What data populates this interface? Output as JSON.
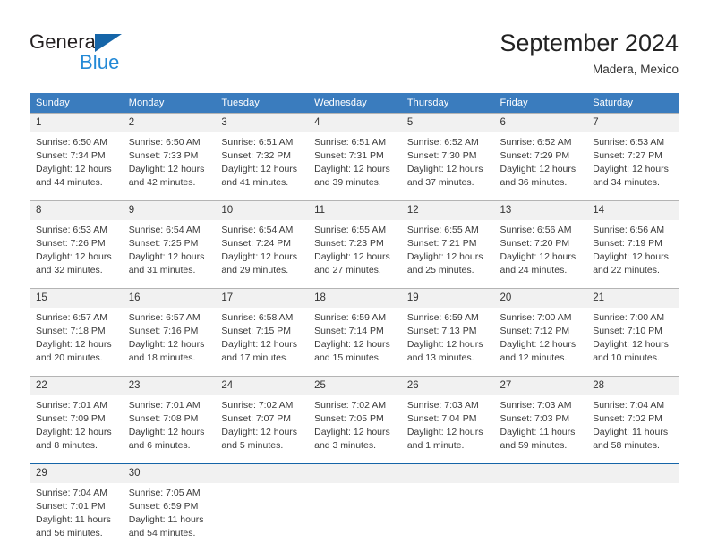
{
  "brand": {
    "name_part1": "General",
    "name_part2": "Blue",
    "triangle_color": "#1565a8",
    "blue_color": "#2389d6"
  },
  "header": {
    "title": "September 2024",
    "location": "Madera, Mexico"
  },
  "theme": {
    "header_bar": "#3a7cbe",
    "daynum_band": "#f1f1f1",
    "rule_gray": "#b4b4b4",
    "rule_blue": "#1565a8"
  },
  "weekday_headers": [
    "Sunday",
    "Monday",
    "Tuesday",
    "Wednesday",
    "Thursday",
    "Friday",
    "Saturday"
  ],
  "labels": {
    "sunrise_prefix": "Sunrise:",
    "sunset_prefix": "Sunset:",
    "daylight_prefix": "Daylight:"
  },
  "weeks": [
    {
      "rule": "gray",
      "days": [
        {
          "num": "1",
          "sunrise": "Sunrise: 6:50 AM",
          "sunset": "Sunset: 7:34 PM",
          "daylight_line1": "Daylight: 12 hours",
          "daylight_line2": "and 44 minutes."
        },
        {
          "num": "2",
          "sunrise": "Sunrise: 6:50 AM",
          "sunset": "Sunset: 7:33 PM",
          "daylight_line1": "Daylight: 12 hours",
          "daylight_line2": "and 42 minutes."
        },
        {
          "num": "3",
          "sunrise": "Sunrise: 6:51 AM",
          "sunset": "Sunset: 7:32 PM",
          "daylight_line1": "Daylight: 12 hours",
          "daylight_line2": "and 41 minutes."
        },
        {
          "num": "4",
          "sunrise": "Sunrise: 6:51 AM",
          "sunset": "Sunset: 7:31 PM",
          "daylight_line1": "Daylight: 12 hours",
          "daylight_line2": "and 39 minutes."
        },
        {
          "num": "5",
          "sunrise": "Sunrise: 6:52 AM",
          "sunset": "Sunset: 7:30 PM",
          "daylight_line1": "Daylight: 12 hours",
          "daylight_line2": "and 37 minutes."
        },
        {
          "num": "6",
          "sunrise": "Sunrise: 6:52 AM",
          "sunset": "Sunset: 7:29 PM",
          "daylight_line1": "Daylight: 12 hours",
          "daylight_line2": "and 36 minutes."
        },
        {
          "num": "7",
          "sunrise": "Sunrise: 6:53 AM",
          "sunset": "Sunset: 7:27 PM",
          "daylight_line1": "Daylight: 12 hours",
          "daylight_line2": "and 34 minutes."
        }
      ]
    },
    {
      "rule": "gray",
      "days": [
        {
          "num": "8",
          "sunrise": "Sunrise: 6:53 AM",
          "sunset": "Sunset: 7:26 PM",
          "daylight_line1": "Daylight: 12 hours",
          "daylight_line2": "and 32 minutes."
        },
        {
          "num": "9",
          "sunrise": "Sunrise: 6:54 AM",
          "sunset": "Sunset: 7:25 PM",
          "daylight_line1": "Daylight: 12 hours",
          "daylight_line2": "and 31 minutes."
        },
        {
          "num": "10",
          "sunrise": "Sunrise: 6:54 AM",
          "sunset": "Sunset: 7:24 PM",
          "daylight_line1": "Daylight: 12 hours",
          "daylight_line2": "and 29 minutes."
        },
        {
          "num": "11",
          "sunrise": "Sunrise: 6:55 AM",
          "sunset": "Sunset: 7:23 PM",
          "daylight_line1": "Daylight: 12 hours",
          "daylight_line2": "and 27 minutes."
        },
        {
          "num": "12",
          "sunrise": "Sunrise: 6:55 AM",
          "sunset": "Sunset: 7:21 PM",
          "daylight_line1": "Daylight: 12 hours",
          "daylight_line2": "and 25 minutes."
        },
        {
          "num": "13",
          "sunrise": "Sunrise: 6:56 AM",
          "sunset": "Sunset: 7:20 PM",
          "daylight_line1": "Daylight: 12 hours",
          "daylight_line2": "and 24 minutes."
        },
        {
          "num": "14",
          "sunrise": "Sunrise: 6:56 AM",
          "sunset": "Sunset: 7:19 PM",
          "daylight_line1": "Daylight: 12 hours",
          "daylight_line2": "and 22 minutes."
        }
      ]
    },
    {
      "rule": "gray",
      "days": [
        {
          "num": "15",
          "sunrise": "Sunrise: 6:57 AM",
          "sunset": "Sunset: 7:18 PM",
          "daylight_line1": "Daylight: 12 hours",
          "daylight_line2": "and 20 minutes."
        },
        {
          "num": "16",
          "sunrise": "Sunrise: 6:57 AM",
          "sunset": "Sunset: 7:16 PM",
          "daylight_line1": "Daylight: 12 hours",
          "daylight_line2": "and 18 minutes."
        },
        {
          "num": "17",
          "sunrise": "Sunrise: 6:58 AM",
          "sunset": "Sunset: 7:15 PM",
          "daylight_line1": "Daylight: 12 hours",
          "daylight_line2": "and 17 minutes."
        },
        {
          "num": "18",
          "sunrise": "Sunrise: 6:59 AM",
          "sunset": "Sunset: 7:14 PM",
          "daylight_line1": "Daylight: 12 hours",
          "daylight_line2": "and 15 minutes."
        },
        {
          "num": "19",
          "sunrise": "Sunrise: 6:59 AM",
          "sunset": "Sunset: 7:13 PM",
          "daylight_line1": "Daylight: 12 hours",
          "daylight_line2": "and 13 minutes."
        },
        {
          "num": "20",
          "sunrise": "Sunrise: 7:00 AM",
          "sunset": "Sunset: 7:12 PM",
          "daylight_line1": "Daylight: 12 hours",
          "daylight_line2": "and 12 minutes."
        },
        {
          "num": "21",
          "sunrise": "Sunrise: 7:00 AM",
          "sunset": "Sunset: 7:10 PM",
          "daylight_line1": "Daylight: 12 hours",
          "daylight_line2": "and 10 minutes."
        }
      ]
    },
    {
      "rule": "gray",
      "days": [
        {
          "num": "22",
          "sunrise": "Sunrise: 7:01 AM",
          "sunset": "Sunset: 7:09 PM",
          "daylight_line1": "Daylight: 12 hours",
          "daylight_line2": "and 8 minutes."
        },
        {
          "num": "23",
          "sunrise": "Sunrise: 7:01 AM",
          "sunset": "Sunset: 7:08 PM",
          "daylight_line1": "Daylight: 12 hours",
          "daylight_line2": "and 6 minutes."
        },
        {
          "num": "24",
          "sunrise": "Sunrise: 7:02 AM",
          "sunset": "Sunset: 7:07 PM",
          "daylight_line1": "Daylight: 12 hours",
          "daylight_line2": "and 5 minutes."
        },
        {
          "num": "25",
          "sunrise": "Sunrise: 7:02 AM",
          "sunset": "Sunset: 7:05 PM",
          "daylight_line1": "Daylight: 12 hours",
          "daylight_line2": "and 3 minutes."
        },
        {
          "num": "26",
          "sunrise": "Sunrise: 7:03 AM",
          "sunset": "Sunset: 7:04 PM",
          "daylight_line1": "Daylight: 12 hours",
          "daylight_line2": "and 1 minute."
        },
        {
          "num": "27",
          "sunrise": "Sunrise: 7:03 AM",
          "sunset": "Sunset: 7:03 PM",
          "daylight_line1": "Daylight: 11 hours",
          "daylight_line2": "and 59 minutes."
        },
        {
          "num": "28",
          "sunrise": "Sunrise: 7:04 AM",
          "sunset": "Sunset: 7:02 PM",
          "daylight_line1": "Daylight: 11 hours",
          "daylight_line2": "and 58 minutes."
        }
      ]
    },
    {
      "rule": "blue",
      "days": [
        {
          "num": "29",
          "sunrise": "Sunrise: 7:04 AM",
          "sunset": "Sunset: 7:01 PM",
          "daylight_line1": "Daylight: 11 hours",
          "daylight_line2": "and 56 minutes."
        },
        {
          "num": "30",
          "sunrise": "Sunrise: 7:05 AM",
          "sunset": "Sunset: 6:59 PM",
          "daylight_line1": "Daylight: 11 hours",
          "daylight_line2": "and 54 minutes."
        },
        {
          "num": "",
          "sunrise": "",
          "sunset": "",
          "daylight_line1": "",
          "daylight_line2": ""
        },
        {
          "num": "",
          "sunrise": "",
          "sunset": "",
          "daylight_line1": "",
          "daylight_line2": ""
        },
        {
          "num": "",
          "sunrise": "",
          "sunset": "",
          "daylight_line1": "",
          "daylight_line2": ""
        },
        {
          "num": "",
          "sunrise": "",
          "sunset": "",
          "daylight_line1": "",
          "daylight_line2": ""
        },
        {
          "num": "",
          "sunrise": "",
          "sunset": "",
          "daylight_line1": "",
          "daylight_line2": ""
        }
      ]
    }
  ]
}
